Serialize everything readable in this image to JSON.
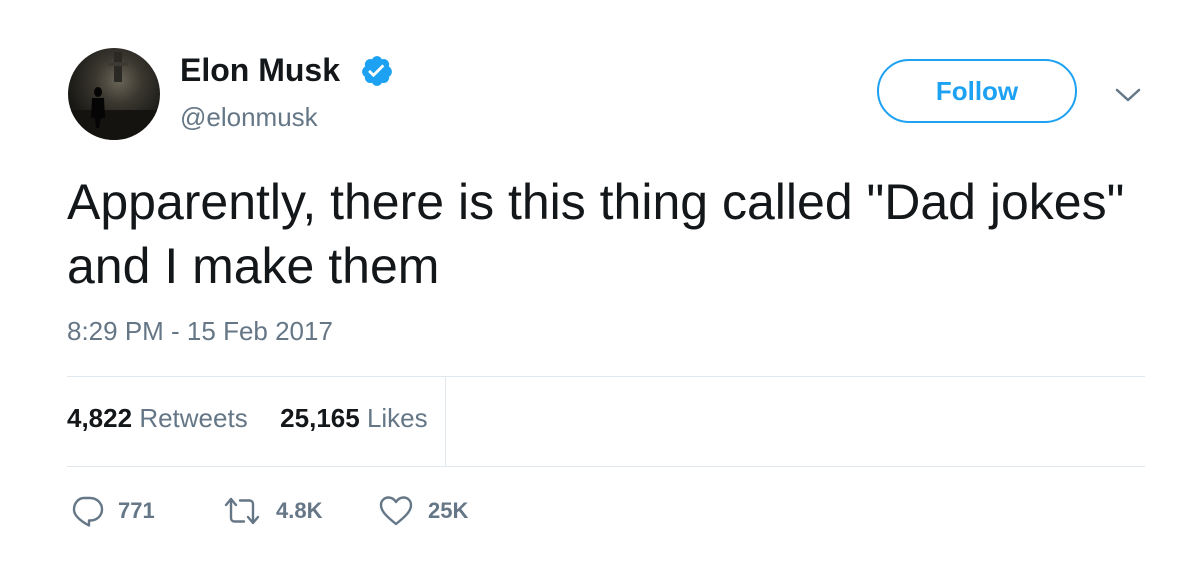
{
  "author": {
    "display_name": "Elon Musk",
    "handle": "@elonmusk",
    "verified": true
  },
  "follow_button": {
    "label": "Follow"
  },
  "tweet": {
    "text": "Apparently, there is this thing called \"Dad jokes\" and I make them",
    "timestamp": "8:29 PM - 15 Feb 2017"
  },
  "stats": {
    "retweets_count": "4,822",
    "retweets_label": "Retweets",
    "likes_count": "25,165",
    "likes_label": "Likes"
  },
  "actions": {
    "reply_count": "771",
    "retweet_count": "4.8K",
    "like_count": "25K"
  },
  "colors": {
    "accent": "#1da1f2",
    "text_primary": "#14171a",
    "text_secondary": "#657786",
    "divider": "#e1e8ed"
  },
  "icons": {
    "verified": "verified-badge-icon",
    "caret": "chevron-down-icon",
    "reply": "reply-icon",
    "retweet": "retweet-icon",
    "like": "heart-icon"
  }
}
